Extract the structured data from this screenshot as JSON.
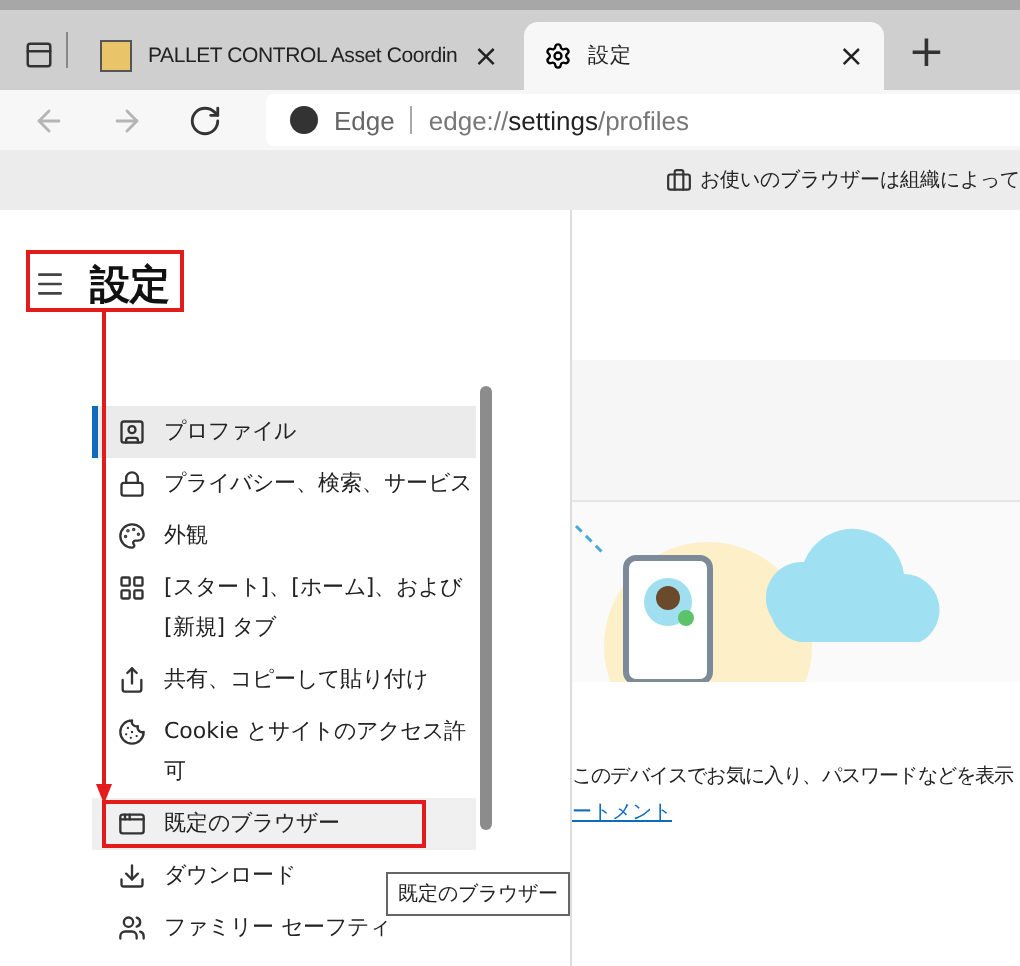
{
  "browser": {
    "tabs": [
      {
        "kind": "page",
        "title": "PALLET CONTROL Asset Coordin",
        "close": "×",
        "selected": false
      },
      {
        "kind": "settings",
        "title": "設定",
        "close": "×",
        "selected": true
      }
    ],
    "new_tab": "+",
    "nav": [
      {
        "kind": "back",
        "disabled": true
      },
      {
        "kind": "forward",
        "disabled": true
      },
      {
        "kind": "refresh",
        "disabled": false
      }
    ],
    "address": {
      "site_label": "Edge",
      "url": "edge://**settings**/profiles"
    }
  },
  "info_bar": {
    "text": "お使いのブラウザーは組織によって"
  },
  "sidebar": {
    "title": "設定",
    "items": [
      {
        "kind": "profile",
        "label": "プロファイル",
        "selected": true,
        "hovered": false,
        "annotated": false
      },
      {
        "kind": "privacy",
        "label": "プライバシー、検索、サービス",
        "selected": false,
        "hovered": false,
        "annotated": false
      },
      {
        "kind": "appearance",
        "label": "外観",
        "selected": false,
        "hovered": false,
        "annotated": false
      },
      {
        "kind": "start",
        "label": "[スタート]、[ホーム]、および [新規] タブ",
        "selected": false,
        "hovered": false,
        "annotated": false
      },
      {
        "kind": "share",
        "label": "共有、コピーして貼り付け",
        "selected": false,
        "hovered": false,
        "annotated": false
      },
      {
        "kind": "cookie",
        "label": "Cookie とサイトのアクセス許可",
        "selected": false,
        "hovered": false,
        "annotated": false
      },
      {
        "kind": "default",
        "label": "既定のブラウザー",
        "selected": false,
        "hovered": true,
        "annotated": true
      },
      {
        "kind": "download",
        "label": "ダウンロード",
        "selected": false,
        "hovered": false,
        "annotated": false
      },
      {
        "kind": "family",
        "label": "ファミリー セーフティ",
        "selected": false,
        "hovered": false,
        "annotated": false
      }
    ]
  },
  "content": {
    "text": "このデバイスでお気に入り、パスワードなどを表示",
    "link": "ートメント"
  },
  "tooltip": "既定のブラウザー"
}
